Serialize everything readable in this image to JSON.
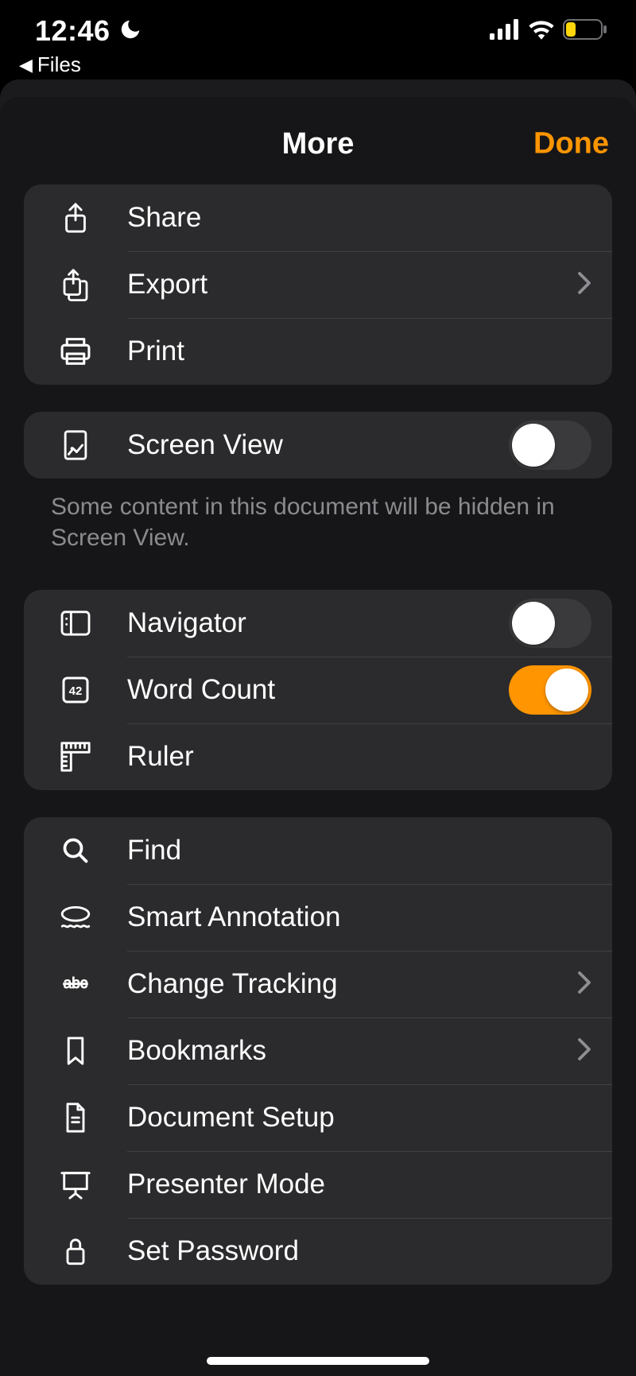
{
  "status": {
    "time": "12:46",
    "back_app_label": "Files"
  },
  "sheet": {
    "title": "More",
    "done": "Done",
    "accent": "#ff9500"
  },
  "group1": {
    "share": "Share",
    "export": "Export",
    "print": "Print"
  },
  "screenview": {
    "label": "Screen View",
    "note": "Some content in this document will be hidden in Screen View.",
    "on": false
  },
  "group3": {
    "navigator": {
      "label": "Navigator",
      "on": false
    },
    "wordcount": {
      "label": "Word Count",
      "on": true
    },
    "ruler": "Ruler"
  },
  "group4": {
    "find": "Find",
    "smart_annotation": "Smart Annotation",
    "change_tracking": "Change Tracking",
    "bookmarks": "Bookmarks",
    "document_setup": "Document Setup",
    "presenter_mode": "Presenter Mode",
    "set_password": "Set Password"
  },
  "colors": {
    "toggle_on": "#ff9500"
  }
}
